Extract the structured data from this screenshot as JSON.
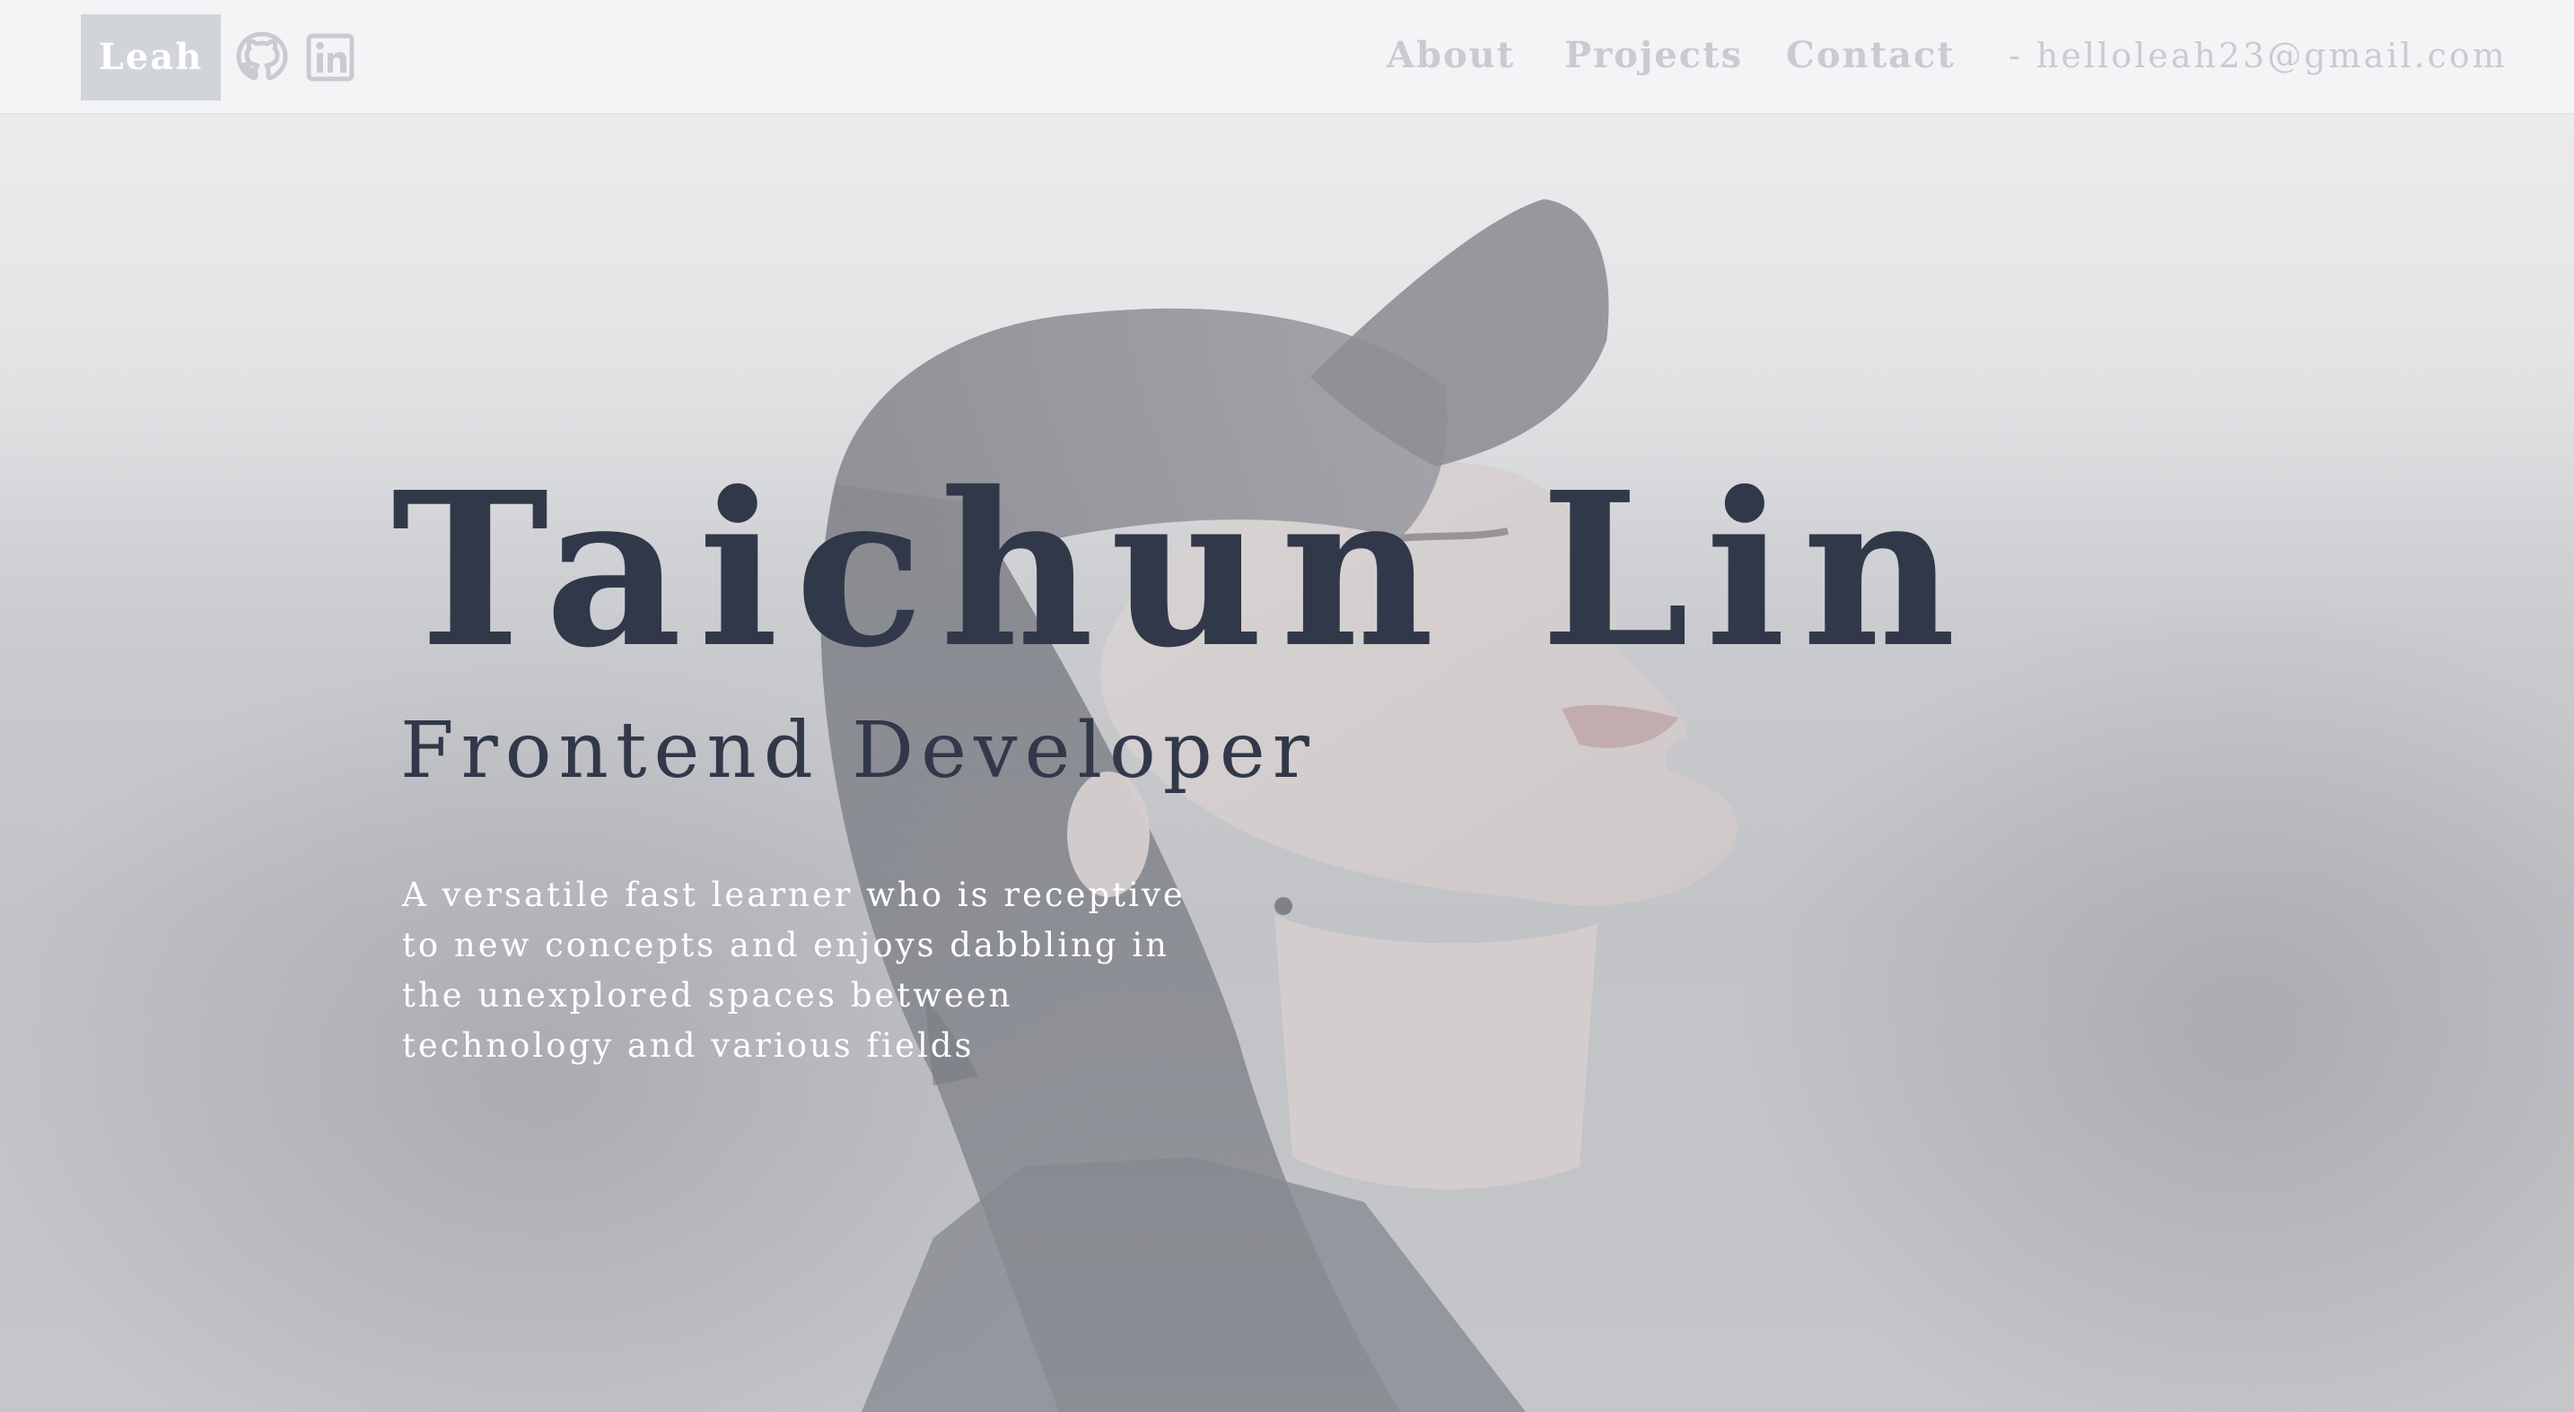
{
  "header": {
    "brand_label": "Leah",
    "social": [
      {
        "icon": "github-icon"
      },
      {
        "icon": "linkedin-icon"
      }
    ],
    "nav": {
      "about": "About",
      "projects": "Projects",
      "contact": "Contact"
    },
    "email": "- helloleah23@gmail.com"
  },
  "hero": {
    "name": "Taichun Lin",
    "role": "Frontend Developer",
    "description": "A versatile fast learner who is receptive to new concepts and enjoys dabbling in the unexplored spaces between technology and various fields"
  },
  "colors": {
    "header_bg": "#f3f4f6",
    "brand_bg": "#d1d4d9",
    "nav_text": "#c9cbd0",
    "heading_text": "#313849",
    "description_text": "#ffffff"
  }
}
